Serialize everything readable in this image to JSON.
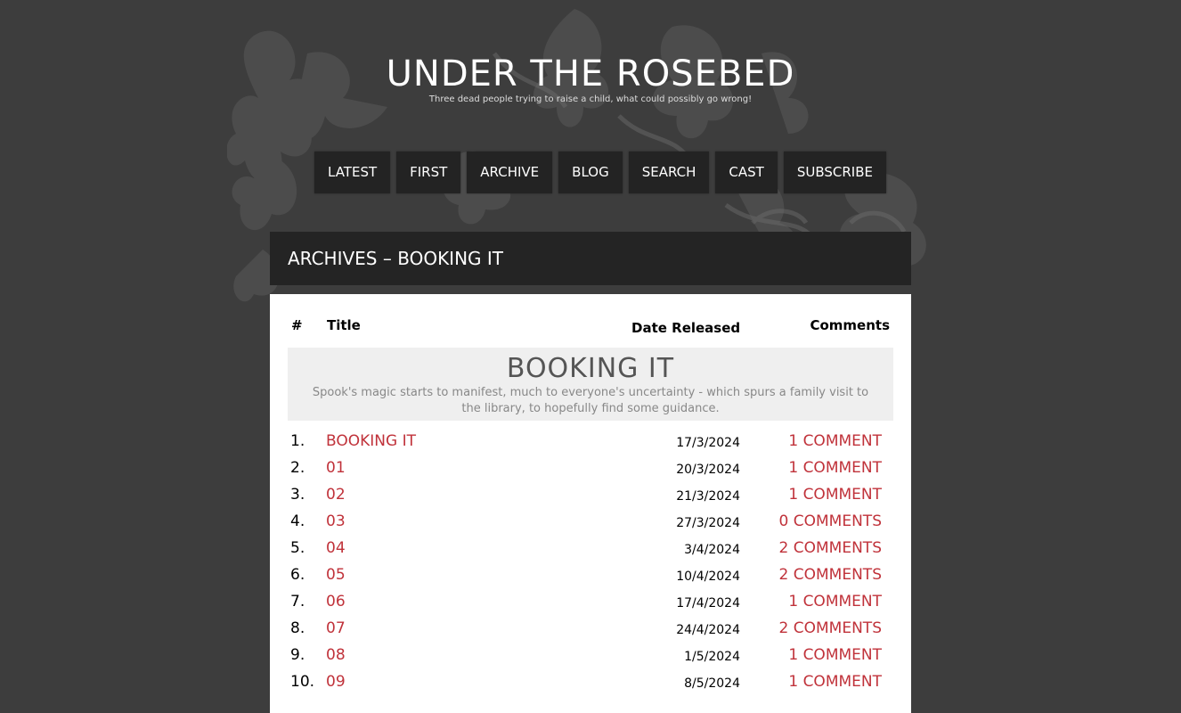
{
  "site": {
    "title": "UNDER THE ROSEBED",
    "tagline": "Three dead people trying to raise a child, what could possibly go wrong!"
  },
  "nav": [
    {
      "label": "LATEST"
    },
    {
      "label": "FIRST"
    },
    {
      "label": "ARCHIVE"
    },
    {
      "label": "BLOG"
    },
    {
      "label": "SEARCH"
    },
    {
      "label": "CAST"
    },
    {
      "label": "SUBSCRIBE"
    }
  ],
  "archive": {
    "heading": "ARCHIVES – BOOKING IT",
    "columns": {
      "num": "#",
      "title": "Title",
      "date": "Date Released",
      "comments": "Comments"
    },
    "chapter": {
      "title": "BOOKING IT",
      "description": "Spook's magic starts to manifest, much to everyone's uncertainty - which spurs a family visit to the library, to hopefully find some guidance."
    },
    "rows": [
      {
        "num": "1.",
        "title": "BOOKING IT",
        "date": "17/3/2024",
        "comments": "1 COMMENT"
      },
      {
        "num": "2.",
        "title": "01",
        "date": "20/3/2024",
        "comments": "1 COMMENT"
      },
      {
        "num": "3.",
        "title": "02",
        "date": "21/3/2024",
        "comments": "1 COMMENT"
      },
      {
        "num": "4.",
        "title": "03",
        "date": "27/3/2024",
        "comments": "0 COMMENTS"
      },
      {
        "num": "5.",
        "title": "04",
        "date": "3/4/2024",
        "comments": "2 COMMENTS"
      },
      {
        "num": "6.",
        "title": "05",
        "date": "10/4/2024",
        "comments": "2 COMMENTS"
      },
      {
        "num": "7.",
        "title": "06",
        "date": "17/4/2024",
        "comments": "1 COMMENT"
      },
      {
        "num": "8.",
        "title": "07",
        "date": "24/4/2024",
        "comments": "2 COMMENTS"
      },
      {
        "num": "9.",
        "title": "08",
        "date": "1/5/2024",
        "comments": "1 COMMENT"
      },
      {
        "num": "10.",
        "title": "09",
        "date": "8/5/2024",
        "comments": "1 COMMENT"
      }
    ]
  },
  "colors": {
    "background": "#3d3d3d",
    "nav_bg": "#232323",
    "link": "#c0323a"
  },
  "icons": {
    "background_decoration": "floral-ornament-icon"
  }
}
